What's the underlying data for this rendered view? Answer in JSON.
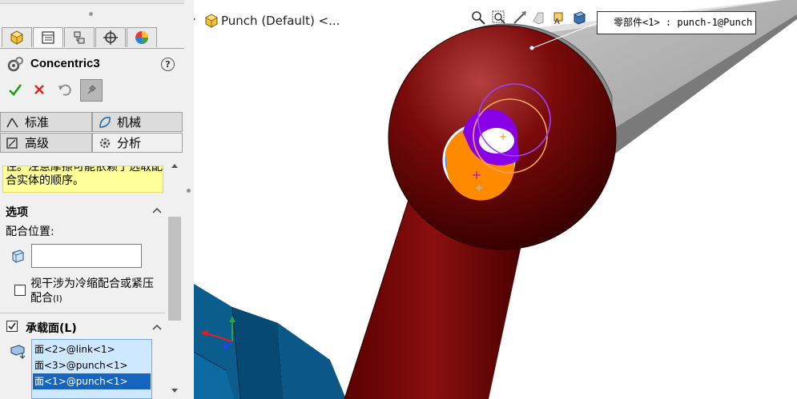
{
  "property_manager": {
    "tabs": [
      {
        "name": "feature-manager-tab"
      },
      {
        "name": "property-manager-tab"
      },
      {
        "name": "configuration-manager-tab"
      },
      {
        "name": "dimxpert-manager-tab"
      },
      {
        "name": "display-manager-tab"
      }
    ],
    "title": "Concentric3",
    "help": "?",
    "mode_tabs": {
      "standard": "标准",
      "mechanical": "机械",
      "advanced": "高级",
      "analysis": "分析"
    },
    "message": "住。注意摩擦可能依赖于选取配合实体的顺序。",
    "options": {
      "header": "选项",
      "mate_location_label": "配合位置:",
      "mate_location_value": "",
      "interference_label": "视干涉为冷缩配合或紧压配合",
      "interference_shortcut": "(I)",
      "interference_checked": false
    },
    "bearing": {
      "header": "承载面",
      "shortcut": "(L)",
      "checked": true,
      "faces": [
        "面<2>@link<1>",
        "面<3>@punch<1>",
        "面<1>@punch<1>"
      ],
      "selected_index": 2
    }
  },
  "viewport": {
    "tree_item": "Punch (Default) <...",
    "tooltip": "零部件<1> : punch-1@Punch",
    "heads_up_icons": [
      "zoom-to-fit-icon",
      "zoom-to-area-icon",
      "previous-view-icon",
      "section-view-icon",
      "view-orientation-icon",
      "display-style-icon"
    ]
  },
  "colors": {
    "selection_blue": "#1565c0",
    "list_bg": "#cde8ff",
    "message_bg": "#ffff99",
    "ball_red": "#8b0000",
    "base_blue": "#0a5a8c",
    "face_orange": "#ff8a00",
    "face_purple": "#8a00e6",
    "face_cyan": "#2f9bff"
  }
}
